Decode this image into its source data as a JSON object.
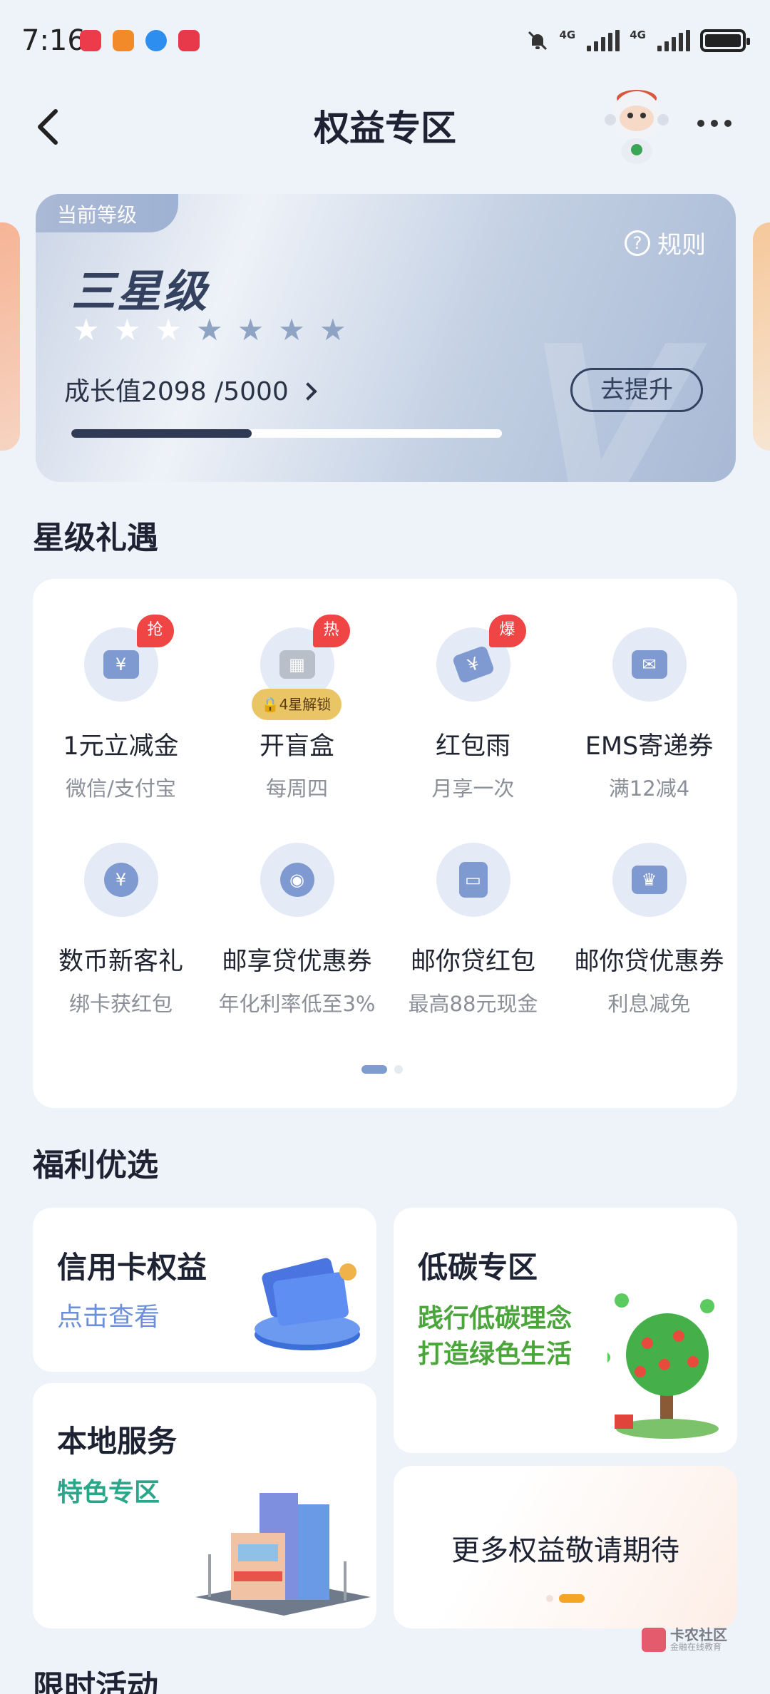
{
  "status_bar": {
    "time": "7:16",
    "network_1": "4G",
    "network_2": "4G"
  },
  "header": {
    "title": "权益专区"
  },
  "level_card": {
    "tag": "当前等级",
    "rule_label": "规则",
    "level_name": "三星级",
    "stars_total": 7,
    "stars_earned": 3,
    "growth_text": "成长值2098 /5000",
    "growth_value": 2098,
    "growth_max": 5000,
    "upgrade_label": "去提升"
  },
  "benefits": {
    "title": "星级礼遇",
    "items": [
      {
        "name": "1元立减金",
        "desc": "微信/支付宝",
        "badge": "抢",
        "icon": "cash-coupon-icon"
      },
      {
        "name": "开盲盒",
        "desc": "每周四",
        "badge": "热",
        "lock": "4星解锁",
        "icon": "gift-box-icon"
      },
      {
        "name": "红包雨",
        "desc": "月享一次",
        "badge": "爆",
        "icon": "red-envelope-icon"
      },
      {
        "name": "EMS寄递券",
        "desc": "满12减4",
        "icon": "mail-envelope-icon"
      },
      {
        "name": "数币新客礼",
        "desc": "绑卡获红包",
        "icon": "digital-currency-icon"
      },
      {
        "name": "邮享贷优惠券",
        "desc": "年化利率低至3%",
        "icon": "loan-hand-icon"
      },
      {
        "name": "邮你贷红包",
        "desc": "最高88元现金",
        "icon": "red-packet-icon"
      },
      {
        "name": "邮你贷优惠券",
        "desc": "利息减免",
        "icon": "crown-icon"
      }
    ]
  },
  "welfare": {
    "title": "福利优选",
    "credit_card": {
      "title": "信用卡权益",
      "sub": "点击查看"
    },
    "low_carbon": {
      "title": "低碳专区",
      "sub_line1": "践行低碳理念",
      "sub_line2": "打造绿色生活"
    },
    "local": {
      "title": "本地服务",
      "sub": "特色专区"
    },
    "more": {
      "title": "更多权益敬请期待"
    }
  },
  "limited": {
    "title": "限时活动"
  },
  "watermark": {
    "line1": "卡农社区",
    "line2": "金融在线教育"
  },
  "colors": {
    "accent_blue": "#7e9ad0",
    "badge_red": "#f04545",
    "green_text": "#4aa63a",
    "teal_text": "#2aa68a",
    "link_blue": "#6b8fd8"
  }
}
